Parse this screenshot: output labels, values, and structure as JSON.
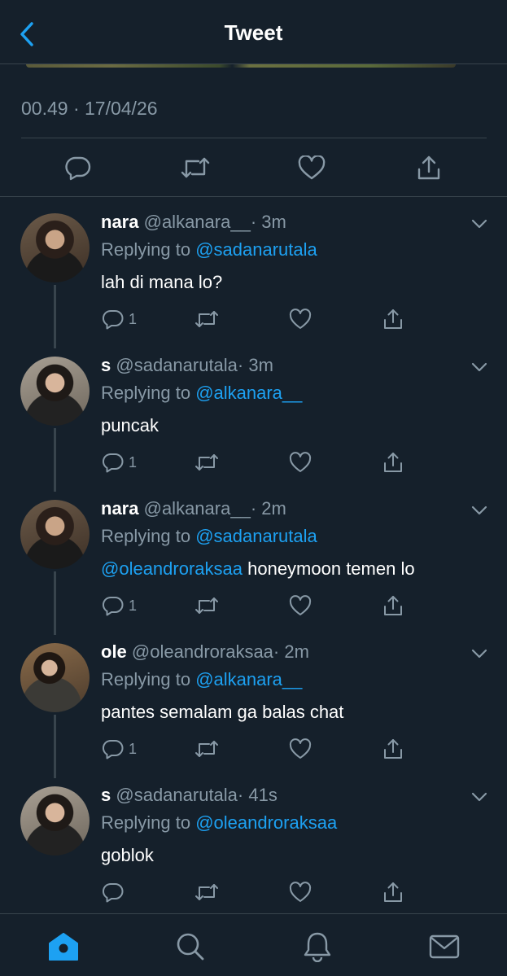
{
  "header": {
    "title": "Tweet",
    "back_icon": "chevron-left-icon"
  },
  "tweet": {
    "timestamp": "00.49 · 17/04/26"
  },
  "main_actions": {
    "icons": [
      "reply-icon",
      "retweet-icon",
      "like-icon",
      "share-icon"
    ]
  },
  "replies": [
    {
      "name": "nara",
      "handle": "@alkanara__",
      "time": "· 3m",
      "replying_prefix": "Replying to ",
      "replying_to": "@sadanarutala",
      "body_mention": "",
      "body_text": "lah di mana lo?",
      "reply_count": "1"
    },
    {
      "name": "s",
      "handle": "@sadanarutala",
      "time": "· 3m",
      "replying_prefix": "Replying to ",
      "replying_to": "@alkanara__",
      "body_mention": "",
      "body_text": "puncak",
      "reply_count": "1"
    },
    {
      "name": "nara",
      "handle": "@alkanara__",
      "time": "· 2m",
      "replying_prefix": "Replying to ",
      "replying_to": "@sadanarutala",
      "body_mention": "@oleandroraksaa",
      "body_text": " honeymoon temen lo",
      "reply_count": "1"
    },
    {
      "name": "ole",
      "handle": "@oleandroraksaa",
      "time": "· 2m",
      "replying_prefix": "Replying to ",
      "replying_to": "@alkanara__",
      "body_mention": "",
      "body_text": "pantes semalam ga balas chat",
      "reply_count": "1"
    },
    {
      "name": "s",
      "handle": "@sadanarutala",
      "time": "· 41s",
      "replying_prefix": "Replying to ",
      "replying_to": "@oleandroraksaa",
      "body_mention": "",
      "body_text": "goblok",
      "reply_count": ""
    }
  ],
  "tabbar": {
    "tabs": [
      "home-icon",
      "search-icon",
      "notifications-icon",
      "messages-icon"
    ],
    "active": "home-icon"
  },
  "colors": {
    "background": "#15202b",
    "accent": "#1da1f2",
    "secondary_text": "#8899a6",
    "divider": "#38444d"
  }
}
